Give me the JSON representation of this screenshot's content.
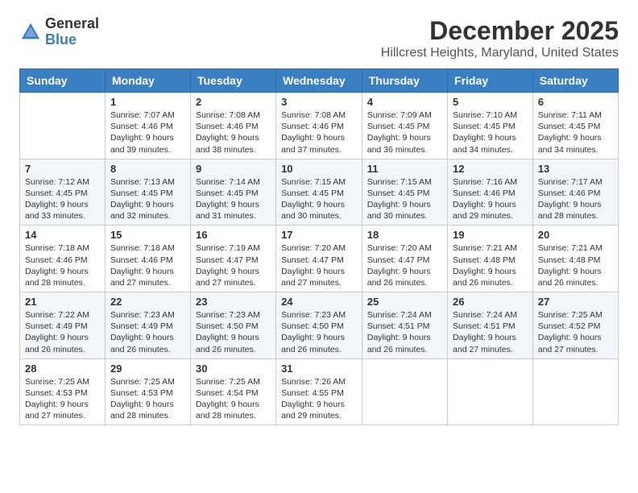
{
  "logo": {
    "general": "General",
    "blue": "Blue"
  },
  "title": "December 2025",
  "subtitle": "Hillcrest Heights, Maryland, United States",
  "days": [
    "Sunday",
    "Monday",
    "Tuesday",
    "Wednesday",
    "Thursday",
    "Friday",
    "Saturday"
  ],
  "weeks": [
    [
      {
        "num": "",
        "info": ""
      },
      {
        "num": "1",
        "info": "Sunrise: 7:07 AM\nSunset: 4:46 PM\nDaylight: 9 hours\nand 39 minutes."
      },
      {
        "num": "2",
        "info": "Sunrise: 7:08 AM\nSunset: 4:46 PM\nDaylight: 9 hours\nand 38 minutes."
      },
      {
        "num": "3",
        "info": "Sunrise: 7:08 AM\nSunset: 4:46 PM\nDaylight: 9 hours\nand 37 minutes."
      },
      {
        "num": "4",
        "info": "Sunrise: 7:09 AM\nSunset: 4:45 PM\nDaylight: 9 hours\nand 36 minutes."
      },
      {
        "num": "5",
        "info": "Sunrise: 7:10 AM\nSunset: 4:45 PM\nDaylight: 9 hours\nand 34 minutes."
      },
      {
        "num": "6",
        "info": "Sunrise: 7:11 AM\nSunset: 4:45 PM\nDaylight: 9 hours\nand 34 minutes."
      }
    ],
    [
      {
        "num": "7",
        "info": "Sunrise: 7:12 AM\nSunset: 4:45 PM\nDaylight: 9 hours\nand 33 minutes."
      },
      {
        "num": "8",
        "info": "Sunrise: 7:13 AM\nSunset: 4:45 PM\nDaylight: 9 hours\nand 32 minutes."
      },
      {
        "num": "9",
        "info": "Sunrise: 7:14 AM\nSunset: 4:45 PM\nDaylight: 9 hours\nand 31 minutes."
      },
      {
        "num": "10",
        "info": "Sunrise: 7:15 AM\nSunset: 4:45 PM\nDaylight: 9 hours\nand 30 minutes."
      },
      {
        "num": "11",
        "info": "Sunrise: 7:15 AM\nSunset: 4:45 PM\nDaylight: 9 hours\nand 30 minutes."
      },
      {
        "num": "12",
        "info": "Sunrise: 7:16 AM\nSunset: 4:46 PM\nDaylight: 9 hours\nand 29 minutes."
      },
      {
        "num": "13",
        "info": "Sunrise: 7:17 AM\nSunset: 4:46 PM\nDaylight: 9 hours\nand 28 minutes."
      }
    ],
    [
      {
        "num": "14",
        "info": "Sunrise: 7:18 AM\nSunset: 4:46 PM\nDaylight: 9 hours\nand 28 minutes."
      },
      {
        "num": "15",
        "info": "Sunrise: 7:18 AM\nSunset: 4:46 PM\nDaylight: 9 hours\nand 27 minutes."
      },
      {
        "num": "16",
        "info": "Sunrise: 7:19 AM\nSunset: 4:47 PM\nDaylight: 9 hours\nand 27 minutes."
      },
      {
        "num": "17",
        "info": "Sunrise: 7:20 AM\nSunset: 4:47 PM\nDaylight: 9 hours\nand 27 minutes."
      },
      {
        "num": "18",
        "info": "Sunrise: 7:20 AM\nSunset: 4:47 PM\nDaylight: 9 hours\nand 26 minutes."
      },
      {
        "num": "19",
        "info": "Sunrise: 7:21 AM\nSunset: 4:48 PM\nDaylight: 9 hours\nand 26 minutes."
      },
      {
        "num": "20",
        "info": "Sunrise: 7:21 AM\nSunset: 4:48 PM\nDaylight: 9 hours\nand 26 minutes."
      }
    ],
    [
      {
        "num": "21",
        "info": "Sunrise: 7:22 AM\nSunset: 4:49 PM\nDaylight: 9 hours\nand 26 minutes."
      },
      {
        "num": "22",
        "info": "Sunrise: 7:23 AM\nSunset: 4:49 PM\nDaylight: 9 hours\nand 26 minutes."
      },
      {
        "num": "23",
        "info": "Sunrise: 7:23 AM\nSunset: 4:50 PM\nDaylight: 9 hours\nand 26 minutes."
      },
      {
        "num": "24",
        "info": "Sunrise: 7:23 AM\nSunset: 4:50 PM\nDaylight: 9 hours\nand 26 minutes."
      },
      {
        "num": "25",
        "info": "Sunrise: 7:24 AM\nSunset: 4:51 PM\nDaylight: 9 hours\nand 26 minutes."
      },
      {
        "num": "26",
        "info": "Sunrise: 7:24 AM\nSunset: 4:51 PM\nDaylight: 9 hours\nand 27 minutes."
      },
      {
        "num": "27",
        "info": "Sunrise: 7:25 AM\nSunset: 4:52 PM\nDaylight: 9 hours\nand 27 minutes."
      }
    ],
    [
      {
        "num": "28",
        "info": "Sunrise: 7:25 AM\nSunset: 4:53 PM\nDaylight: 9 hours\nand 27 minutes."
      },
      {
        "num": "29",
        "info": "Sunrise: 7:25 AM\nSunset: 4:53 PM\nDaylight: 9 hours\nand 28 minutes."
      },
      {
        "num": "30",
        "info": "Sunrise: 7:25 AM\nSunset: 4:54 PM\nDaylight: 9 hours\nand 28 minutes."
      },
      {
        "num": "31",
        "info": "Sunrise: 7:26 AM\nSunset: 4:55 PM\nDaylight: 9 hours\nand 29 minutes."
      },
      {
        "num": "",
        "info": ""
      },
      {
        "num": "",
        "info": ""
      },
      {
        "num": "",
        "info": ""
      }
    ]
  ]
}
